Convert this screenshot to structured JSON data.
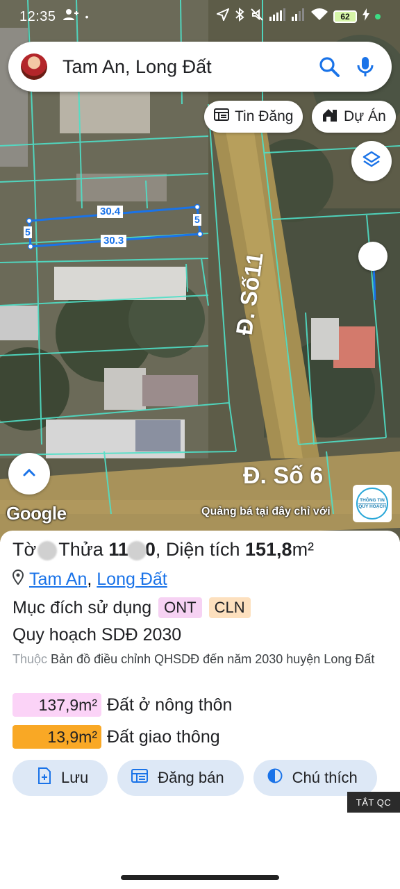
{
  "status_bar": {
    "time": "12:35",
    "battery": "62",
    "icons": [
      "person-add-icon",
      "location-arrow-icon",
      "bluetooth-icon",
      "mute-icon",
      "signal-icon",
      "wifi-icon",
      "battery-icon",
      "charging-icon"
    ]
  },
  "search": {
    "query": "Tam An, Long Đất",
    "search_icon": "search-icon",
    "mic_icon": "mic-icon"
  },
  "chips": {
    "tin_dang": "Tin Đăng",
    "du_an": "Dự Án"
  },
  "map": {
    "streets": [
      "Đ. Số11",
      "Đ. Số 6"
    ],
    "measurements": [
      "30.4",
      "5",
      "30.3",
      "5"
    ],
    "attribution": "Google",
    "promo": "Quảng bá tại đây chỉ với",
    "badge_line1": "THÔNG TIN",
    "badge_line2": "QUY HOẠCH",
    "colors": {
      "parcel_outline": "#4fe0c8",
      "measure_line": "#1a73e8"
    }
  },
  "parcel": {
    "to_label": "Tờ",
    "thua_label": "Thửa",
    "thua_value": "11",
    "thua_tail": "0",
    "dien_tich_label": ", Diện tích",
    "dien_tich_value": "151,8",
    "dien_tich_unit": "m²",
    "location_part1": "Tam An",
    "location_sep": ",",
    "location_part2": "Long Đất",
    "muc_dich_label": "Mục đích sử dụng",
    "badges": [
      {
        "text": "ONT",
        "color": "#f6d2f3"
      },
      {
        "text": "CLN",
        "color": "#fde0be"
      }
    ],
    "quy_hoach": "Quy hoạch SDĐ 2030",
    "thuoc_label": "Thuộc",
    "thuoc_text": "Bản đồ điều chỉnh QHSDĐ đến năm 2030 huyện Long Đất",
    "land_uses": [
      {
        "area": "137,9m²",
        "label": "Đất ở nông thôn",
        "color": "#fbd3f7"
      },
      {
        "area": "13,9m²",
        "label": "Đất giao thông",
        "color": "#f9a825"
      }
    ]
  },
  "actions": {
    "luu": "Lưu",
    "dang_ban": "Đăng bán",
    "chu_thich": "Chú thích"
  },
  "ad_toggle": "TẮT QC"
}
